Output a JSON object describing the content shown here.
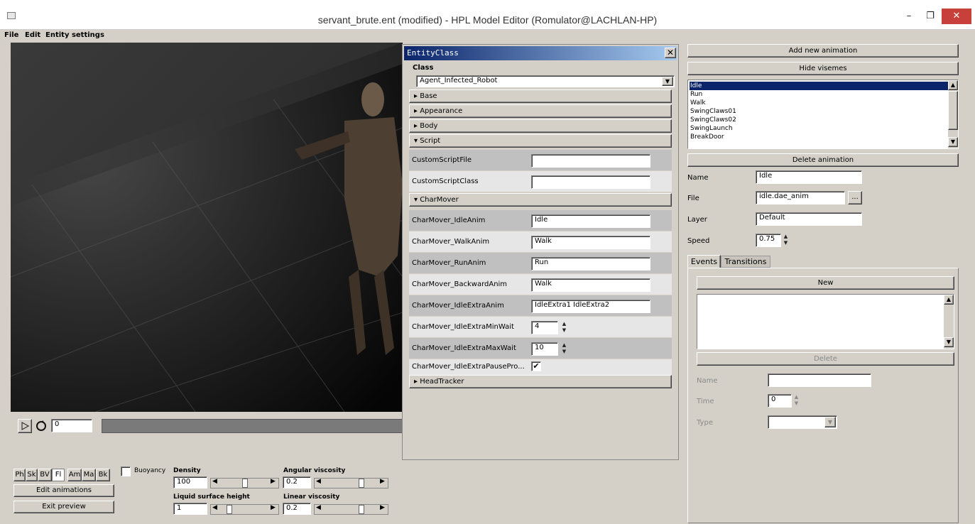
{
  "window": {
    "title": "servant_brute.ent (modified) - HPL Model Editor  (Romulator@LACHLAN-HP)",
    "min_glyph": "–",
    "max_glyph": "❐",
    "close_glyph": "✕"
  },
  "menu": [
    "File",
    "Edit",
    "Entity settings"
  ],
  "playback": {
    "frame": "0"
  },
  "entity_panel": {
    "title": "EntityClass",
    "close_glyph": "✕",
    "class_label": "Class",
    "class_value": "Agent_Infected_Robot",
    "sections_collapsed": [
      "Base",
      "Appearance",
      "Body"
    ],
    "script_section": "Script",
    "custom_script_file_label": "CustomScriptFile",
    "custom_script_file_value": "",
    "custom_script_class_label": "CustomScriptClass",
    "custom_script_class_value": "",
    "charmover_section": "CharMover",
    "idle_anim_label": "CharMover_IdleAnim",
    "idle_anim_value": "Idle",
    "walk_anim_label": "CharMover_WalkAnim",
    "walk_anim_value": "Walk",
    "run_anim_label": "CharMover_RunAnim",
    "run_anim_value": "Run",
    "backward_anim_label": "CharMover_BackwardAnim",
    "backward_anim_value": "Walk",
    "idle_extra_anim_label": "CharMover_IdleExtraAnim",
    "idle_extra_anim_value": "IdleExtra1 IdleExtra2",
    "idle_extra_min_label": "CharMover_IdleExtraMinWait",
    "idle_extra_min_value": "4",
    "idle_extra_max_label": "CharMover_IdleExtraMaxWait",
    "idle_extra_max_value": "10",
    "idle_extra_pause_label": "CharMover_IdleExtraPausePro...",
    "idle_extra_pause_checked": "✔",
    "headtracker_section": "HeadTracker"
  },
  "animations": {
    "add_label": "Add new animation",
    "hide_visemes_label": "Hide visemes",
    "list": [
      "Idle",
      "Run",
      "Walk",
      "SwingClaws01",
      "SwingClaws02",
      "SwingLaunch",
      "BreakDoor"
    ],
    "selected_index": 0,
    "delete_label": "Delete animation",
    "name_label": "Name",
    "name_value": "Idle",
    "file_label": "File",
    "file_value": "idle.dae_anim",
    "browse_label": "...",
    "layer_label": "Layer",
    "layer_value": "Default",
    "speed_label": "Speed",
    "speed_value": "0.75"
  },
  "events": {
    "tab_events": "Events",
    "tab_transitions": "Transitions",
    "new_label": "New",
    "delete_label": "Delete",
    "name_label": "Name",
    "name_value": "",
    "time_label": "Time",
    "time_value": "0",
    "type_label": "Type",
    "type_value": ""
  },
  "physics": {
    "toggles": [
      "Ph",
      "Sk",
      "BV",
      "Fl",
      "Am",
      "Ma",
      "Bk"
    ],
    "buoyancy_label": "Buoyancy",
    "density_label": "Density",
    "density_value": "100",
    "angular_viscosity_label": "Angular viscosity",
    "angular_viscosity_value": "0.2",
    "liquid_surface_label": "Liquid surface height",
    "liquid_surface_value": "1",
    "linear_viscosity_label": "Linear viscosity",
    "linear_viscosity_value": "0.2",
    "edit_animations_label": "Edit animations",
    "exit_preview_label": "Exit preview"
  }
}
